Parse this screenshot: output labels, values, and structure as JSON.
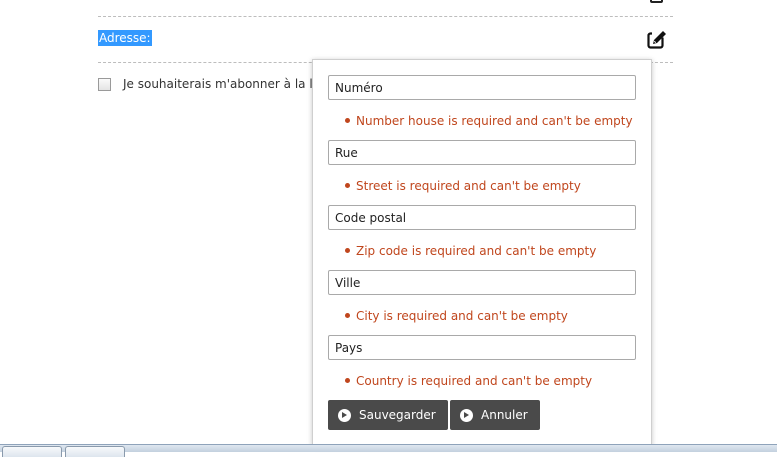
{
  "address_label": "Adresse:",
  "newsletter": {
    "label": "Je souhaiterais m'abonner à la lett"
  },
  "form": {
    "fields": [
      {
        "placeholder": "Numéro",
        "error": "Number house is required and can't be empty"
      },
      {
        "placeholder": "Rue",
        "error": "Street is required and can't be empty"
      },
      {
        "placeholder": "Code postal",
        "error": "Zip code is required and can't be empty"
      },
      {
        "placeholder": "Ville",
        "error": "City is required and can't be empty"
      },
      {
        "placeholder": "Pays",
        "error": "Country is required and can't be empty"
      }
    ],
    "save_label": "Sauvegarder",
    "cancel_label": "Annuler"
  },
  "icons": {
    "edit": "edit-icon",
    "button": "circle-chevron-right-icon"
  },
  "colors": {
    "error": "#c0461d",
    "selection": "#3399ff",
    "button": "#4a4a4a"
  }
}
